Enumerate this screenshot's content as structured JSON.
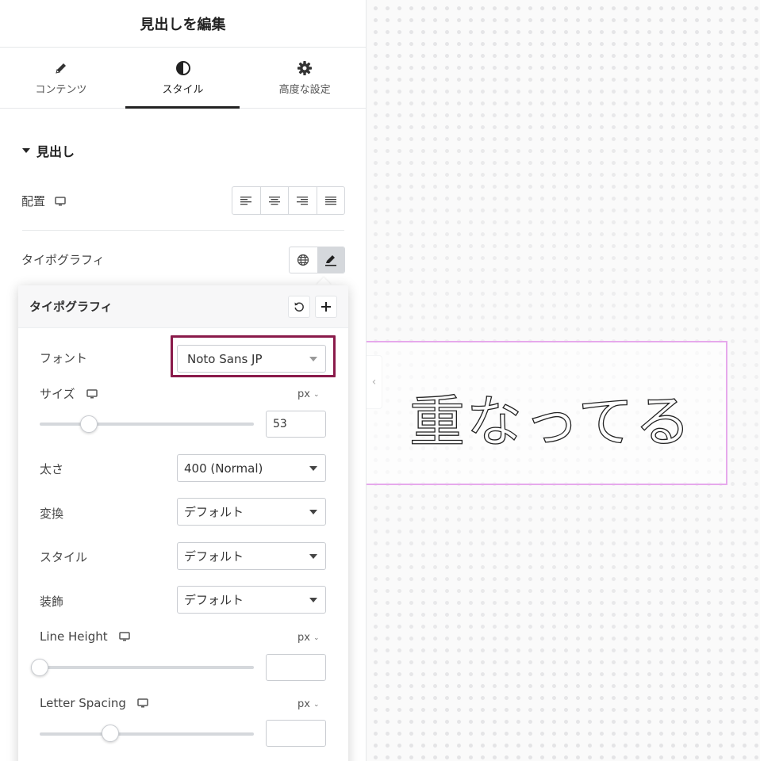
{
  "panel": {
    "title": "見出しを編集",
    "tabs": [
      {
        "label": "コンテンツ",
        "icon": "pencil-icon"
      },
      {
        "label": "スタイル",
        "icon": "half-circle-icon",
        "active": true
      },
      {
        "label": "高度な設定",
        "icon": "gear-icon"
      }
    ],
    "section_title": "見出し",
    "alignment_label": "配置",
    "typography_label": "タイポグラフィ"
  },
  "popover": {
    "title": "タイポグラフィ",
    "font_label": "フォント",
    "font_value": "Noto Sans JP",
    "size_label": "サイズ",
    "size_unit": "px",
    "size_value": "53",
    "size_slider_level": 0.23,
    "weight_label": "太さ",
    "weight_value": "400 (Normal)",
    "transform_label": "変換",
    "transform_value": "デフォルト",
    "style_label": "スタイル",
    "style_value": "デフォルト",
    "decoration_label": "装飾",
    "decoration_value": "デフォルト",
    "line_height_label": "Line Height",
    "line_height_unit": "px",
    "line_height_value": "",
    "line_height_slider_level": 0.0,
    "letter_spacing_label": "Letter Spacing",
    "letter_spacing_unit": "px",
    "letter_spacing_value": "",
    "letter_spacing_slider_level": 0.33
  },
  "canvas": {
    "heading_text": "重なってる",
    "highlight_color": "#8a1a4a",
    "frame_color": "#e6a9ec"
  }
}
